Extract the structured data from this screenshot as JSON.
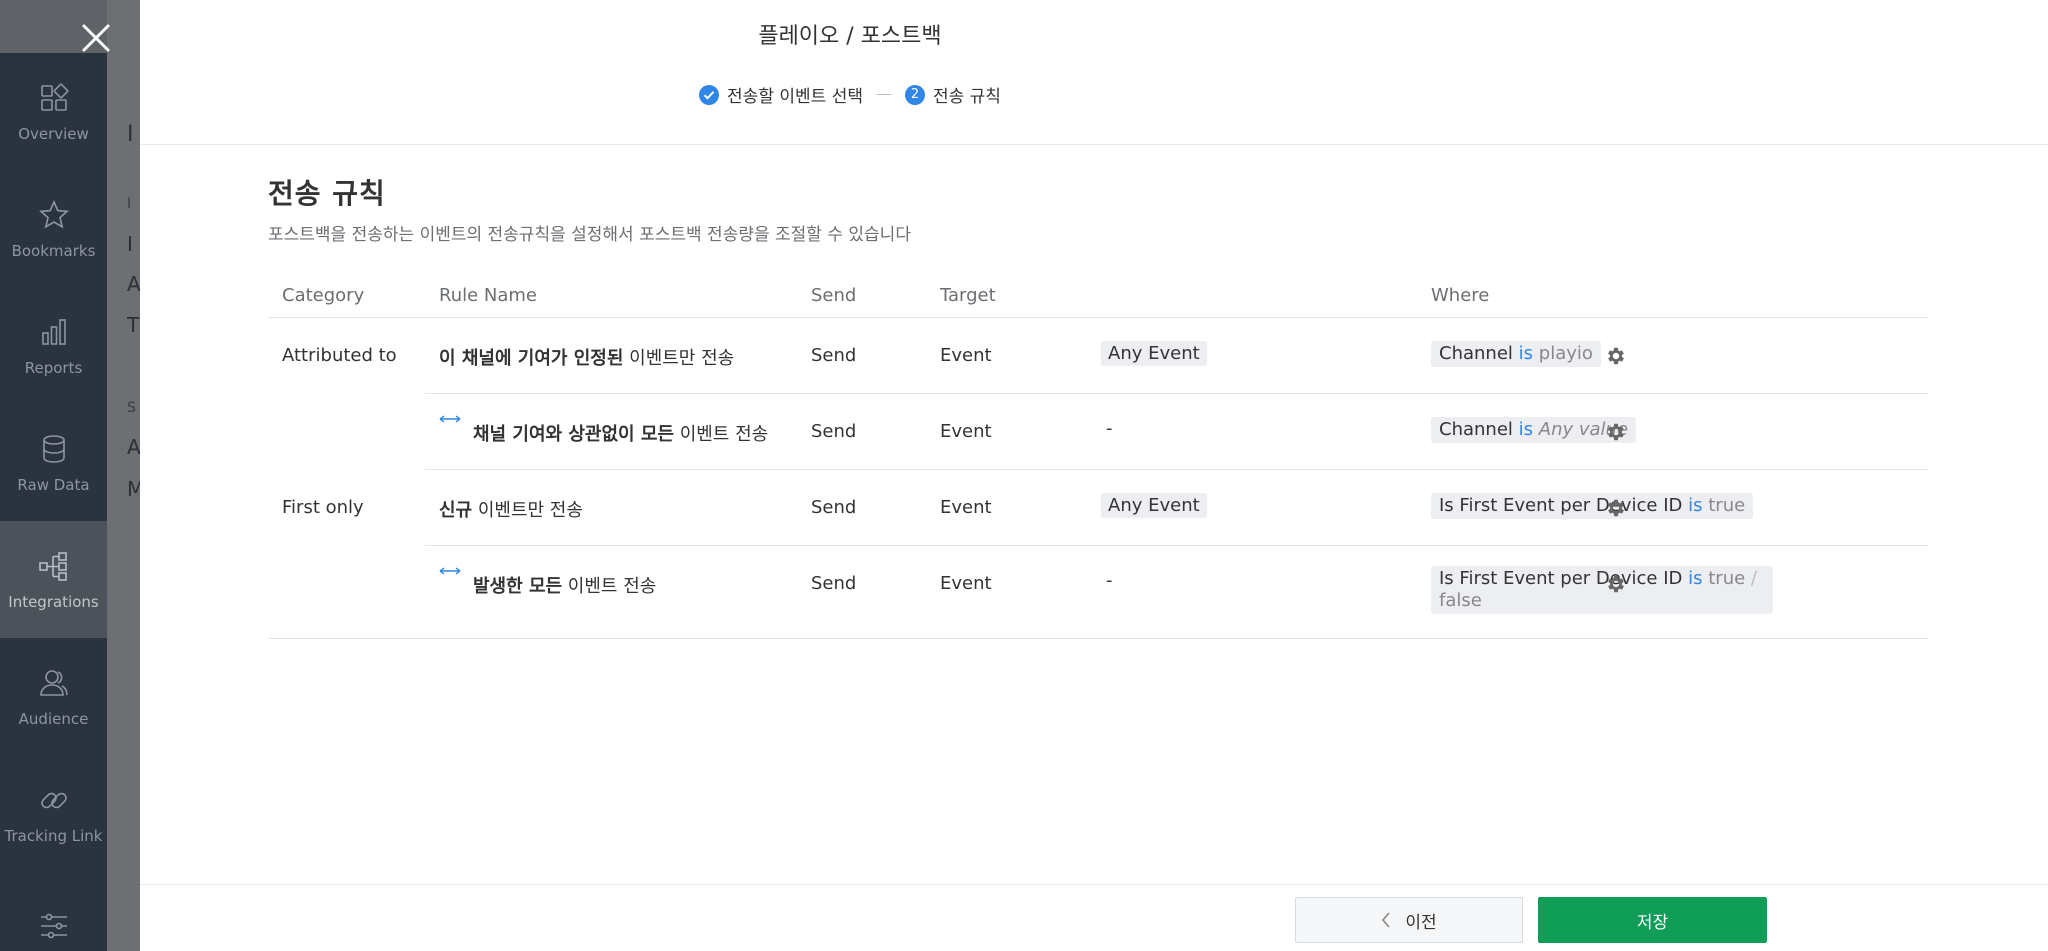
{
  "sidebar": {
    "items": [
      {
        "label": "Overview",
        "icon": "overview-icon",
        "active": false
      },
      {
        "label": "Bookmarks",
        "icon": "star-icon",
        "active": false
      },
      {
        "label": "Reports",
        "icon": "bar-chart-icon",
        "active": false
      },
      {
        "label": "Raw Data",
        "icon": "database-icon",
        "active": false
      },
      {
        "label": "Integrations",
        "icon": "integrations-icon",
        "active": true
      },
      {
        "label": "Audience",
        "icon": "audience-icon",
        "active": false
      },
      {
        "label": "Tracking Link",
        "icon": "link-icon",
        "active": false
      },
      {
        "label": "",
        "icon": "sliders-icon",
        "active": false
      }
    ]
  },
  "background": {
    "frag1": "I",
    "frag2": "I",
    "frag3": "I",
    "frag4": "A",
    "frag5": "T",
    "frag6": "S",
    "frag7": "A",
    "frag8": "M"
  },
  "modal": {
    "title": "플레이오 / 포스트백",
    "steps": [
      {
        "label": "전송할 이벤트 선택",
        "state": "done"
      },
      {
        "num": "2",
        "label": "전송 규칙",
        "state": "current"
      }
    ]
  },
  "section": {
    "title": "전송 규칙",
    "desc": "포스트백을 전송하는 이벤트의 전송규칙을 설정해서 포스트백 전송량을 조절할 수 있습니다"
  },
  "table": {
    "headers": {
      "category": "Category",
      "rule": "Rule Name",
      "send": "Send",
      "target": "Target",
      "where": "Where"
    },
    "rows": [
      {
        "category": "Attributed to",
        "rule_bold": "이 채널에 기여가 인정된",
        "rule_rest": " 이벤트만 전송",
        "send": "Send",
        "target": "Event",
        "event": "Any Event",
        "where_field": "Channel",
        "where_op": "is",
        "where_val": "playio"
      },
      {
        "category": "",
        "rule_bold": "채널 기여와 상관없이 모든",
        "rule_rest": " 이벤트 전송",
        "send": "Send",
        "target": "Event",
        "event": "-",
        "where_field": "Channel",
        "where_op": "is",
        "where_val": "Any value"
      },
      {
        "category": "First only",
        "rule_bold": "신규",
        "rule_rest": " 이벤트만 전송",
        "send": "Send",
        "target": "Event",
        "event": "Any Event",
        "where_field": "Is First Event per Device ID",
        "where_op": "is",
        "where_val": "true"
      },
      {
        "category": "",
        "rule_bold": "발생한 모든",
        "rule_rest": " 이벤트 전송",
        "send": "Send",
        "target": "Event",
        "event": "-",
        "where_field": "Is First Event per Device ID",
        "where_op": "is",
        "where_val": "true",
        "where_sep": " / ",
        "where_val2": "false"
      }
    ]
  },
  "footer": {
    "prev_label": "이전",
    "save_label": "저장"
  },
  "colors": {
    "accent": "#2f86e6",
    "save": "#0f9d58",
    "sidebar": "#2b3340"
  }
}
